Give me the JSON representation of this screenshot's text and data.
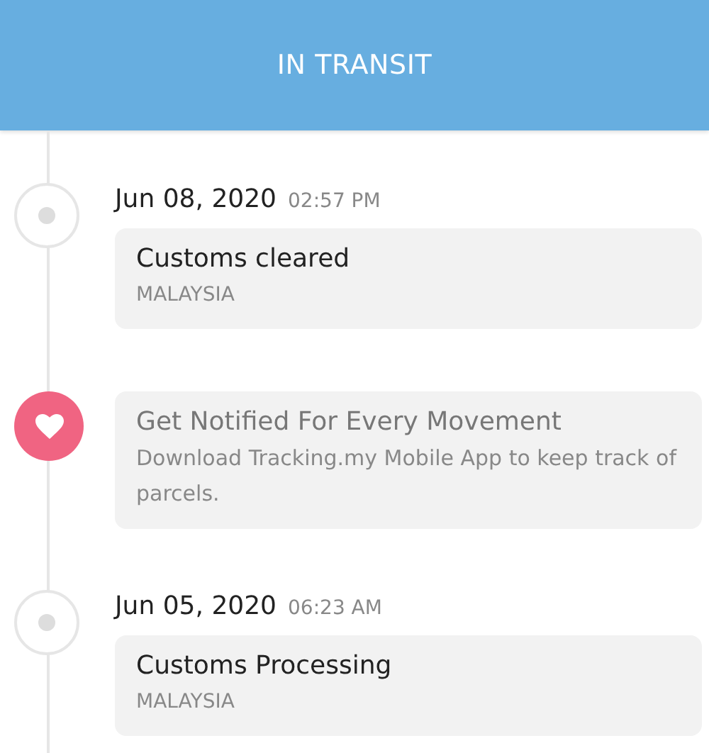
{
  "header": {
    "title": "IN TRANSIT"
  },
  "timeline": [
    {
      "kind": "event",
      "date": "Jun 08, 2020",
      "time": "02:57 PM",
      "status": "Customs cleared",
      "location": "MALAYSIA"
    },
    {
      "kind": "promo",
      "title": "Get Notified For Every Movement",
      "text": "Download Tracking.my Mobile App to keep track of parcels."
    },
    {
      "kind": "event",
      "date": "Jun 05, 2020",
      "time": "06:23 AM",
      "status": "Customs Processing",
      "location": "MALAYSIA"
    }
  ]
}
